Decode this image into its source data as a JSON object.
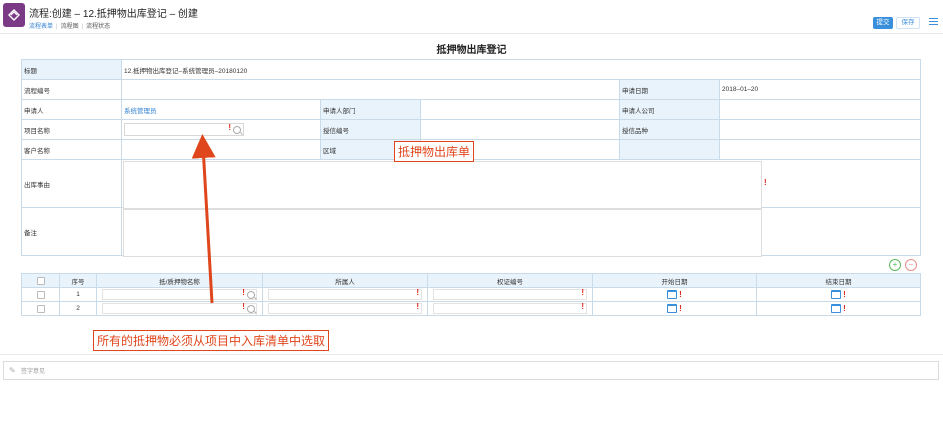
{
  "header": {
    "title": "流程:创建 – 12.抵押物出库登记 – 创建",
    "tabs": [
      {
        "label": "流程表单",
        "active": true
      },
      {
        "label": "流程图",
        "active": false
      },
      {
        "label": "流程状态",
        "active": false
      }
    ],
    "submit_label": "提交",
    "save_label": "保存"
  },
  "form": {
    "title": "抵押物出库登记",
    "labels": {
      "title": "标题",
      "flow_no": "流程编号",
      "apply_date": "申请日期",
      "applicant": "申请人",
      "dept": "申请人部门",
      "company": "申请人公司",
      "project": "项目名称",
      "credit_no": "授信编号",
      "credit_type": "授信品种",
      "customer": "客户名称",
      "region": "区域",
      "reason": "出库事由",
      "remark": "备注"
    },
    "values": {
      "title": "12.抵押物出库登记–系统管理员–20180120",
      "apply_date": "2018–01–20",
      "applicant": "系统管理员",
      "required_mark": "!"
    }
  },
  "detail_table": {
    "headers": [
      "序号",
      "抵/质押物名称",
      "所属人",
      "权证编号",
      "开始日期",
      "结束日期"
    ],
    "rows": [
      {
        "no": "1"
      },
      {
        "no": "2"
      }
    ],
    "add_symbol": "+",
    "remove_symbol": "−"
  },
  "annotations": {
    "callout_1": "抵押物出库单",
    "callout_2": "所有的抵押物必须从项目中入库清单中选取",
    "color": "#e0461b"
  },
  "comment": {
    "placeholder": "签字意见"
  },
  "colors": {
    "accent": "#3a8fdc",
    "logo": "#7a3a86",
    "label_bg": "#e9f3fb",
    "required": "#e0261b"
  }
}
